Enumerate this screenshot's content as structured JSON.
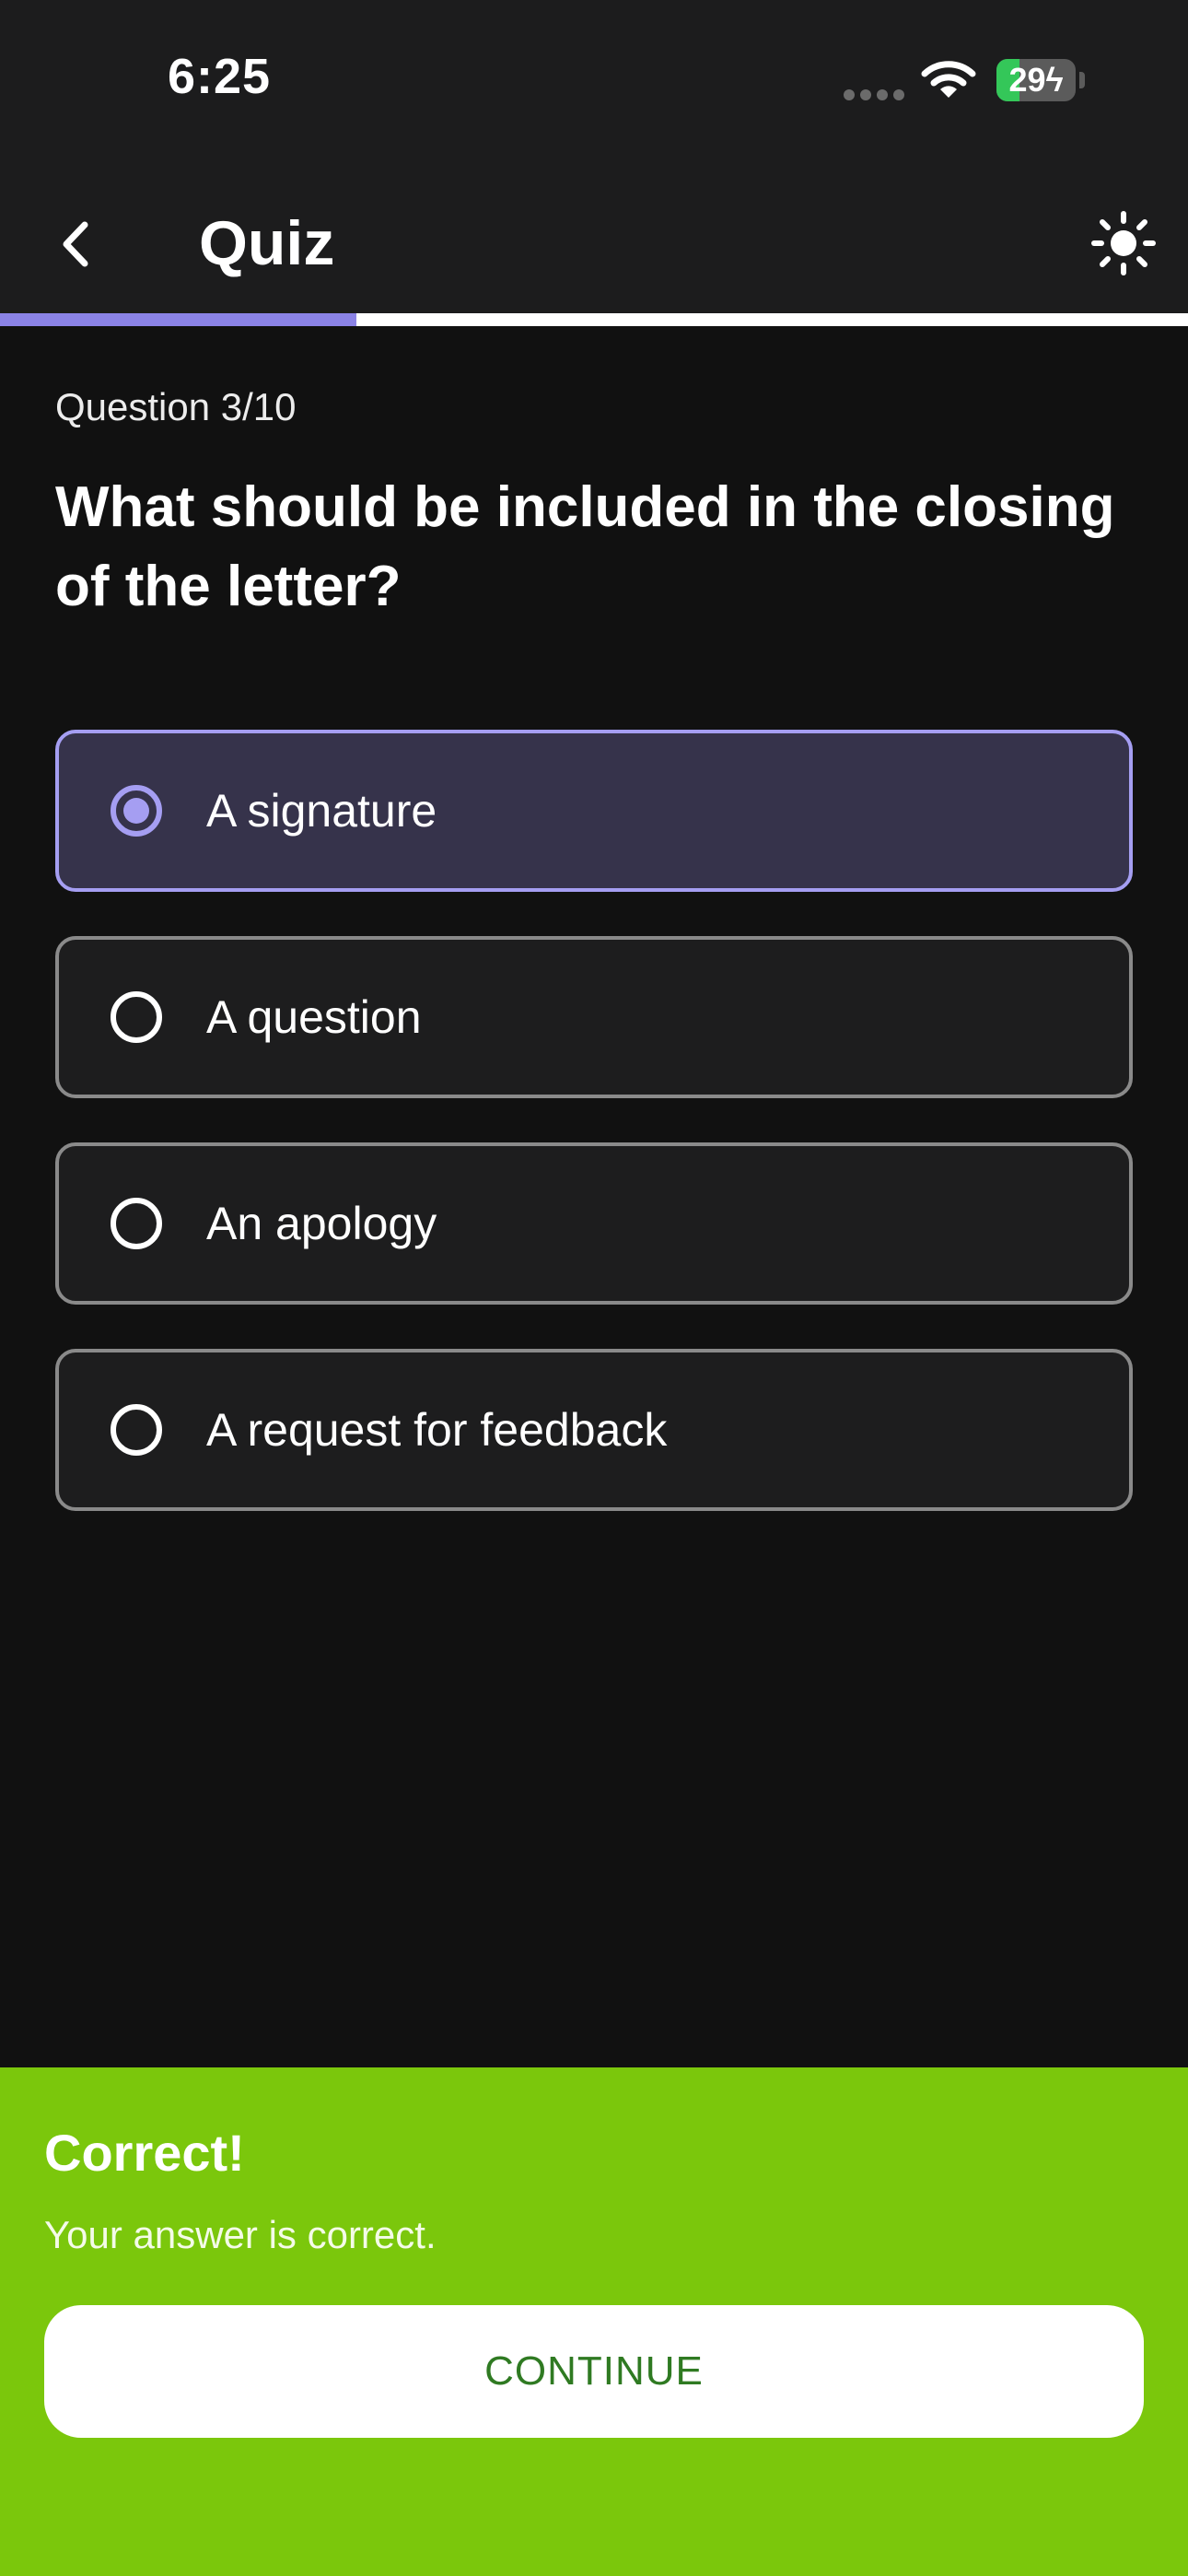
{
  "status_bar": {
    "time": "6:25",
    "battery_level": "29",
    "battery_fraction": 0.29,
    "signal_icon": "cellular-signal-icon",
    "wifi_icon": "wifi-icon",
    "charging_icon": "charging-bolt-icon"
  },
  "app_bar": {
    "title": "Quiz",
    "back_icon": "chevron-left-icon",
    "theme_icon": "sun-icon"
  },
  "progress": {
    "current": 3,
    "total": 10,
    "fraction": 0.3
  },
  "question": {
    "counter": "Question 3/10",
    "text": "What should be included in the closing of the letter?"
  },
  "options": [
    {
      "label": "A signature",
      "selected": true
    },
    {
      "label": "A question",
      "selected": false
    },
    {
      "label": "An apology",
      "selected": false
    },
    {
      "label": "A request for feedback",
      "selected": false
    }
  ],
  "feedback": {
    "title": "Correct!",
    "message": "Your answer is correct.",
    "button_label": "CONTINUE"
  },
  "colors": {
    "accent": "#8b83e6",
    "selected_border": "#a59ef2",
    "selected_bg": "#36334b",
    "success": "#7bc70c",
    "continue_text": "#2f7a22",
    "background": "#111111"
  }
}
